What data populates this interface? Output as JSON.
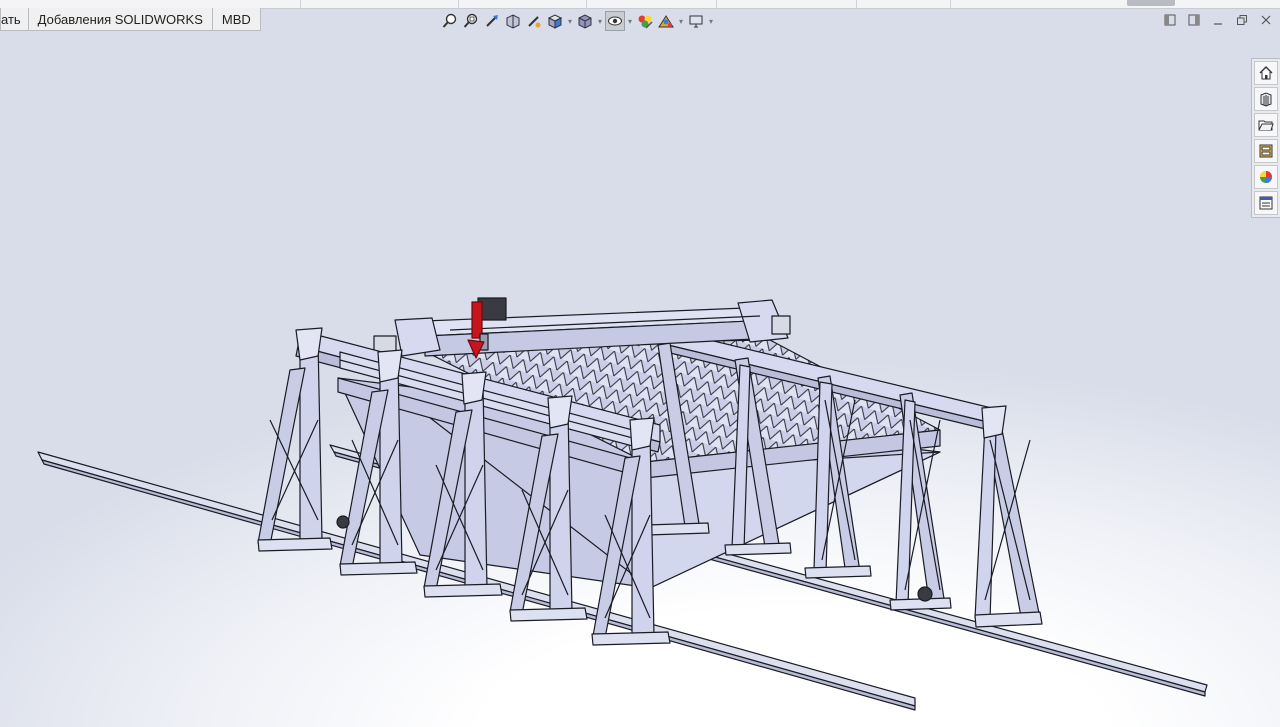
{
  "tabs": [
    {
      "label": "ать"
    },
    {
      "label": "Добавления SOLIDWORKS"
    },
    {
      "label": "MBD"
    }
  ],
  "heads_up_toolbar": {
    "icons": [
      "zoom-to-fit-icon",
      "zoom-to-area-icon",
      "previous-view-icon",
      "section-view-icon",
      "dynamic-annotation-view-icon",
      "view-orientation-icon",
      "display-style-icon",
      "hide-show-items-icon",
      "edit-appearance-icon",
      "apply-scene-icon",
      "view-settings-icon"
    ]
  },
  "window_controls": [
    "tile-left-icon",
    "tile-right-icon",
    "minimize-icon",
    "restore-icon",
    "close-icon"
  ],
  "task_pane": {
    "items": [
      "home-icon",
      "design-library-icon",
      "file-explorer-icon",
      "view-palette-icon",
      "appearances-icon",
      "custom-properties-icon"
    ]
  },
  "colors": {
    "background_top": "#d9dde9",
    "background_floor": "#ffffff",
    "model_fill": "#cdd1e9",
    "model_edge": "#1a1c24",
    "torch_red": "#c4161c"
  }
}
